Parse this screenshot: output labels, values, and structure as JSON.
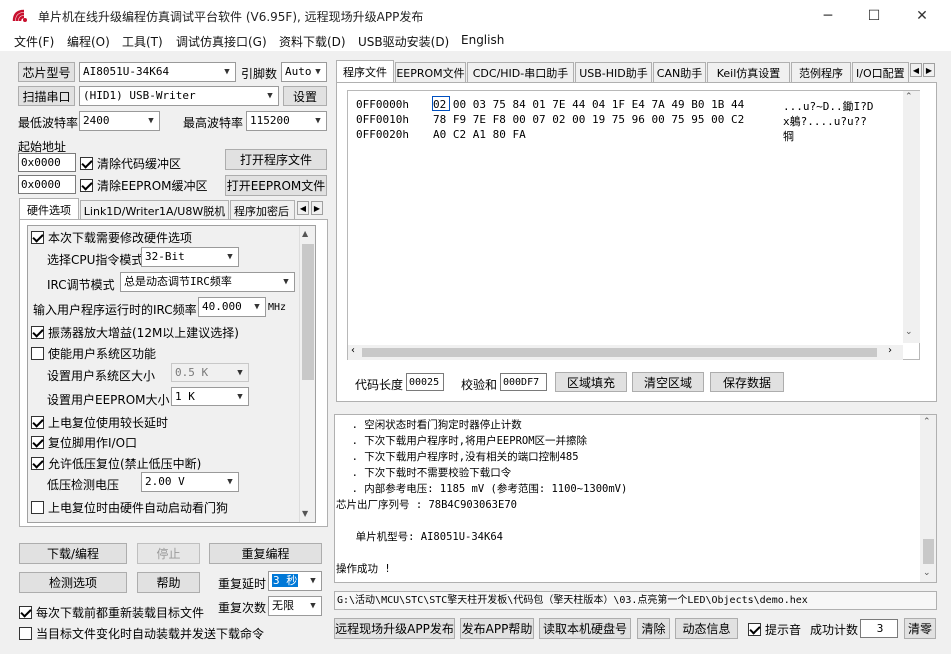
{
  "window": {
    "title": "单片机在线升级编程仿真调试平台软件 (V6.95F), 远程现场升级APP发布",
    "min": "─",
    "max": "☐",
    "close": "✕"
  },
  "menu": [
    "文件(F)",
    "编程(O)",
    "工具(T)",
    "调试仿真接口(G)",
    "资料下载(D)",
    "USB驱动安装(D)",
    "English"
  ],
  "left": {
    "chip_btn": "芯片型号",
    "chip_val": "AI8051U-34K64",
    "pins_label": "引脚数",
    "pins_val": "Auto",
    "scan_btn": "扫描串口",
    "port_val": "(HID1) USB-Writer",
    "settings_btn": "设置",
    "min_baud_label": "最低波特率",
    "min_baud_val": "2400",
    "max_baud_label": "最高波特率",
    "max_baud_val": "115200",
    "start_addr_label": "起始地址",
    "addr1": "0x0000",
    "clear_code": "清除代码缓冲区",
    "open_prog": "打开程序文件",
    "addr2": "0x0000",
    "clear_eeprom": "清除EEPROM缓冲区",
    "open_eeprom": "打开EEPROM文件",
    "tabs": [
      "硬件选项",
      "Link1D/Writer1A/U8W脱机",
      "程序加密后"
    ],
    "tab_arrows": [
      "◀",
      "▶"
    ],
    "opts": {
      "o1": "本次下载需要修改硬件选项",
      "cpu_label": "选择CPU指令模式",
      "cpu_val": "32-Bit",
      "irc_label": "IRC调节模式",
      "irc_val": "总是动态调节IRC频率",
      "freq_label": "输入用户程序运行时的IRC频率",
      "freq_val": "40.000",
      "freq_unit": "MHz",
      "o2": "振荡器放大增益(12M以上建议选择)",
      "o3": "使能用户系统区功能",
      "sys_label": "设置用户系统区大小",
      "sys_val": "0.5 K",
      "ee_label": "设置用户EEPROM大小",
      "ee_val": "1   K",
      "o4": "上电复位使用较长延时",
      "o5": "复位脚用作I/O口",
      "o6": "允许低压复位(禁止低压中断)",
      "lv_label": "低压检测电压",
      "lv_val": "2.00 V",
      "o7": "上电复位时由硬件自动启动看门狗"
    },
    "download_btn": "下载/编程",
    "stop_btn": "停止",
    "reprog_btn": "重复编程",
    "detect_btn": "检测选项",
    "help_btn": "帮助",
    "delay_label": "重复延时",
    "delay_val": "3 秒",
    "count_label": "重复次数",
    "count_val": "无限",
    "reload_chk": "每次下载前都重新装载目标文件",
    "auto_chk": "当目标文件变化时自动装载并发送下载命令"
  },
  "right": {
    "tabs": [
      "程序文件",
      "EEPROM文件",
      "CDC/HID-串口助手",
      "USB-HID助手",
      "CAN助手",
      "Keil仿真设置",
      "范例程序",
      "I/O口配置"
    ],
    "hex": [
      {
        "addr": "0FF0000h",
        "bytes": "02 00 03 75 84 01 7E 44 04 1F E4 7A 49 B0 1B 44",
        "ascii": "...u?~D..鋤I?D"
      },
      {
        "addr": "0FF0010h",
        "bytes": "78 F9 7E F8 00 07 02 00 19 75 96 00 75 95 00 C2",
        "ascii": "x鵢?....u?u??"
      },
      {
        "addr": "0FF0020h",
        "bytes": "A0 C2 A1 80 FA",
        "ascii": "犅   "
      }
    ],
    "code_len_label": "代码长度",
    "code_len_val": "00025",
    "checksum_label": "校验和",
    "checksum_val": "000DF7",
    "fill_btn": "区域填充",
    "clear_btn": "清空区域",
    "save_btn": "保存数据",
    "log": [
      "  . 空闲状态时看门狗定时器停止计数",
      "  . 下次下载用户程序时,将用户EEPROM区一并擦除",
      "  . 下次下载用户程序时,没有相关的端口控制485",
      "  . 下次下载时不需要校验下载口令",
      "  . 内部参考电压: 1185 mV (参考范围: 1100~1300mV)",
      "芯片出厂序列号 : 78B4C903063E70",
      "",
      "  单片机型号: AI8051U-34K64",
      "",
      "操作成功 !"
    ],
    "path": "G:\\活动\\MCU\\STC\\STC擎天柱开发板\\代码包（擎天柱版本）\\03.点亮第一个LED\\Objects\\demo.hex",
    "remote_btn": "远程现场升级APP发布",
    "publish_help_btn": "发布APP帮助",
    "read_disk_btn": "读取本机硬盘号",
    "clear2_btn": "清除",
    "dynamic_btn": "动态信息",
    "beep_chk": "提示音",
    "success_label": "成功计数",
    "success_val": "3",
    "reset_btn": "清零"
  }
}
